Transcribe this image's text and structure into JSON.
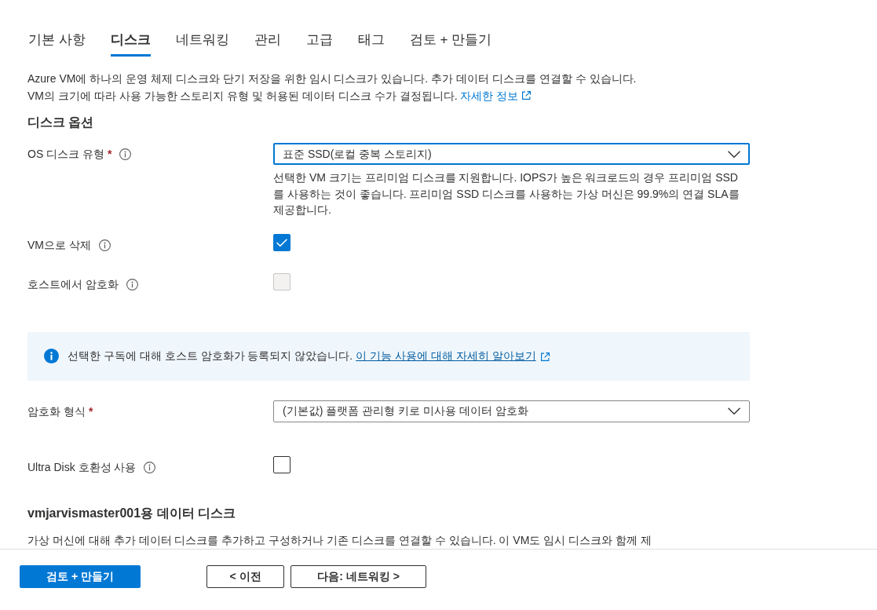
{
  "tabs": [
    {
      "label": "기본 사항",
      "selected": false
    },
    {
      "label": "디스크",
      "selected": true
    },
    {
      "label": "네트워킹",
      "selected": false
    },
    {
      "label": "관리",
      "selected": false
    },
    {
      "label": "고급",
      "selected": false
    },
    {
      "label": "태그",
      "selected": false
    },
    {
      "label": "검토 + 만들기",
      "selected": false
    }
  ],
  "intro": {
    "lines": [
      "Azure VM에 하나의 운영 체제 디스크와 단기 저장을 위한 임시 디스크가 있습니다. 추가 데이터 디스크를 연결할 수 있습니다.",
      "VM의 크기에 따라 사용 가능한 스토리지 유형 및 허용된 데이터 디스크 수가 결정됩니다."
    ],
    "link": "자세한 정보"
  },
  "disk_options": {
    "heading": "디스크 옵션",
    "fields": [
      {
        "kind": "select",
        "label": "OS 디스크 유형",
        "required_mark": "*",
        "info": true,
        "value": "표준 SSD(로컬 중복 스토리지)",
        "focused": true,
        "help": "선택한 VM 크기는 프리미엄 디스크를 지원합니다. IOPS가 높은 워크로드의 경우 프리미엄 SSD를 사용하는 것이 좋습니다. 프리미엄 SSD 디스크를 사용하는 가상 머신은 99.9%의 연결 SLA를 제공합니다."
      },
      {
        "kind": "checkbox",
        "label": "VM으로 삭제",
        "info": true,
        "checked": true,
        "disabled": false
      },
      {
        "kind": "checkbox",
        "label": "호스트에서 암호화",
        "info": true,
        "checked": false,
        "disabled": true
      },
      {
        "kind": "notice",
        "text": "선택한 구독에 대해 호스트 암호화가 등록되지 않았습니다.",
        "link": "이 기능 사용에 대해 자세히 알아보기"
      },
      {
        "kind": "select",
        "label": "암호화 형식",
        "required_mark": "*",
        "info": false,
        "value": "(기본값) 플랫폼 관리형 키로 미사용 데이터 암호화",
        "focused": false
      },
      {
        "kind": "checkbox",
        "label": "Ultra Disk 호환성 사용",
        "info": true,
        "checked": false,
        "disabled": false
      }
    ]
  },
  "data_disks": {
    "heading": "vmjarvismaster001용 데이터 디스크",
    "text": "가상 머신에 대해 추가 데이터 디스크를 추가하고 구성하거나 기존 디스크를 연결할 수 있습니다. 이 VM도 임시 디스크와 함께 제"
  },
  "footer": {
    "buttons": [
      {
        "label": "검토 + 만들기",
        "kind": "primary"
      },
      {
        "label": "< 이전",
        "kind": "secondary"
      },
      {
        "label": "다음: 네트워킹 >",
        "kind": "secondary"
      }
    ]
  }
}
